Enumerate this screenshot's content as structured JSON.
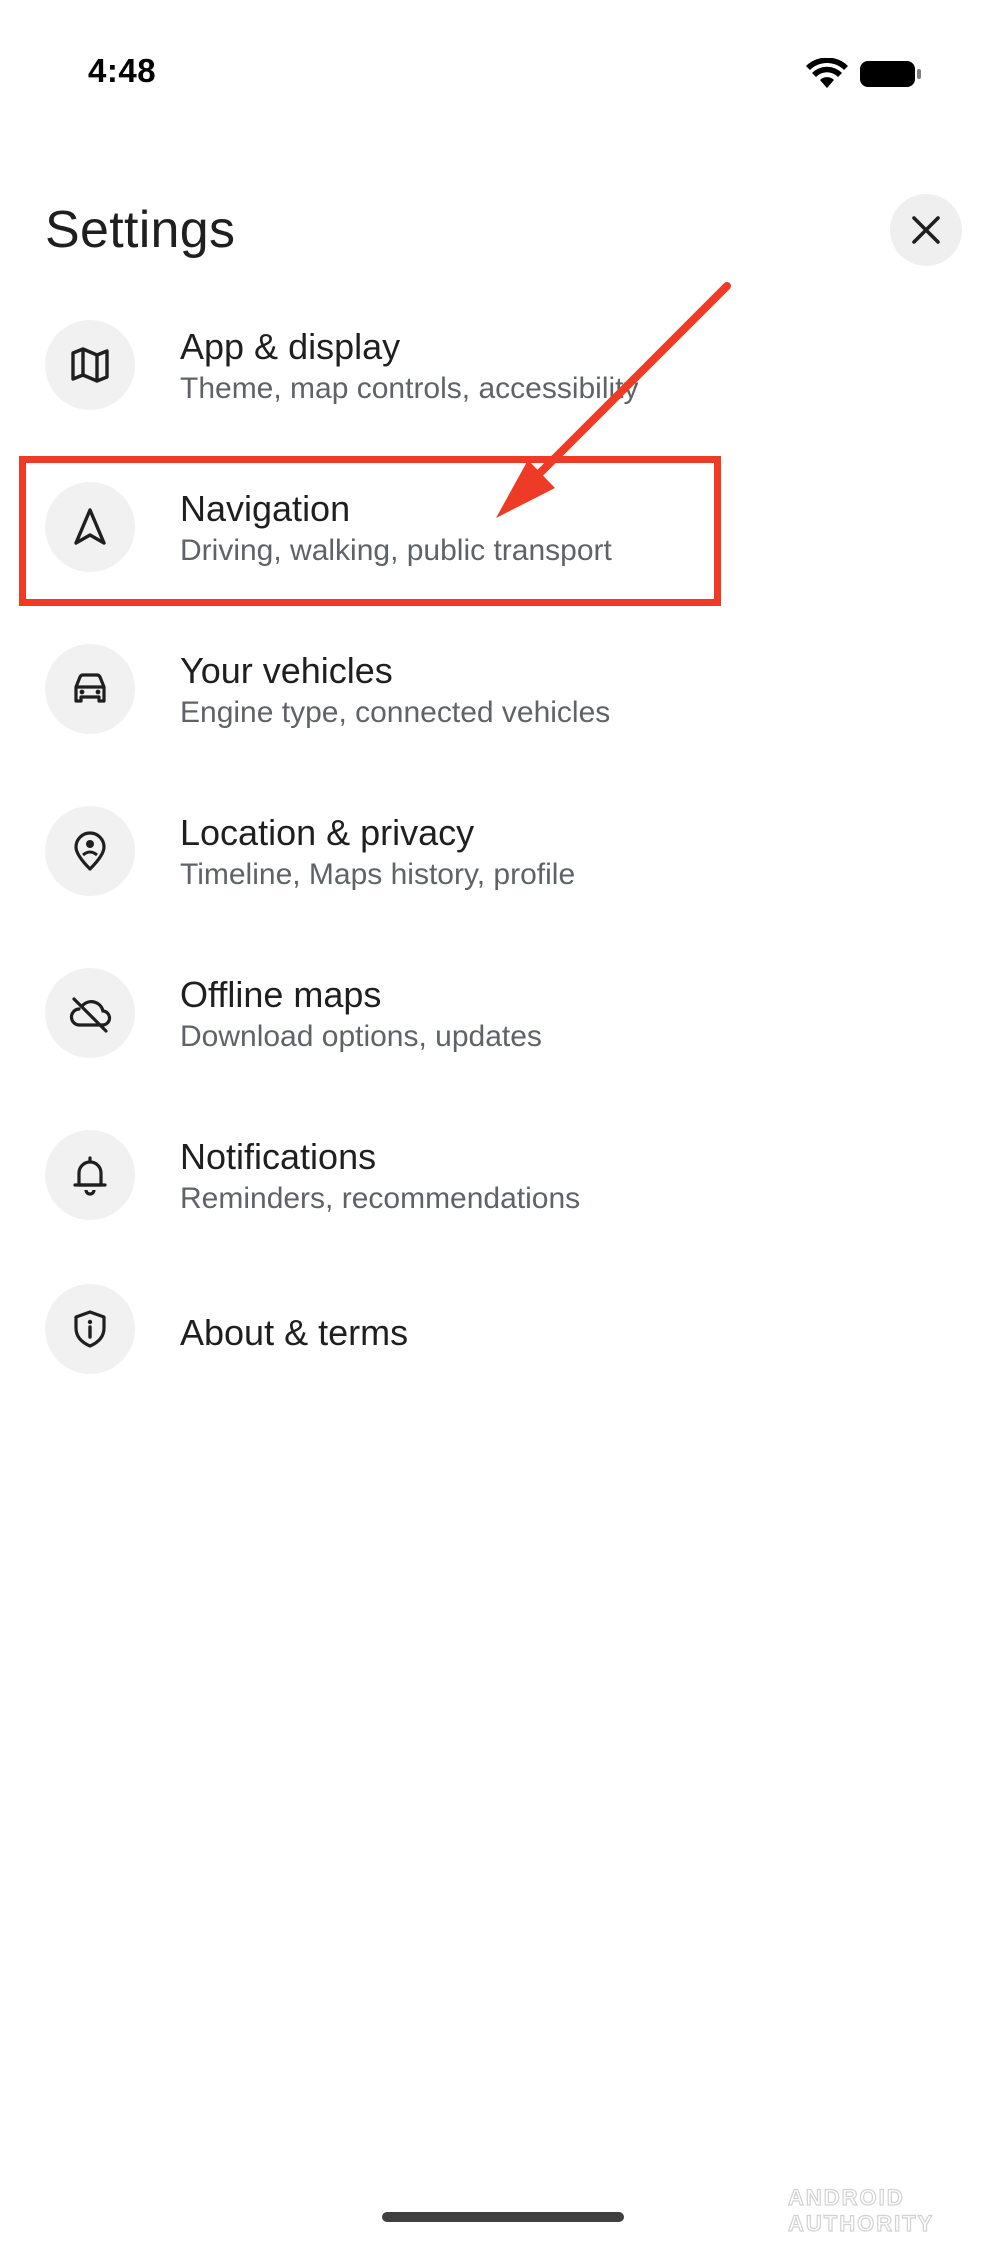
{
  "status_bar": {
    "time": "4:48"
  },
  "page": {
    "title": "Settings"
  },
  "settings_items": [
    {
      "label": "App & display",
      "sub": "Theme, map controls, accessibility",
      "icon": "map-icon"
    },
    {
      "label": "Navigation",
      "sub": "Driving, walking, public transport",
      "icon": "navigation-arrow-icon"
    },
    {
      "label": "Your vehicles",
      "sub": "Engine type, connected vehicles",
      "icon": "car-icon"
    },
    {
      "label": "Location & privacy",
      "sub": "Timeline, Maps history, profile",
      "icon": "location-person-icon"
    },
    {
      "label": "Offline maps",
      "sub": "Download options, updates",
      "icon": "cloud-off-icon"
    },
    {
      "label": "Notifications",
      "sub": "Reminders, recommendations",
      "icon": "bell-icon"
    },
    {
      "label": "About & terms",
      "icon": "shield-info-icon"
    }
  ],
  "annotation": {
    "highlight_color": "#ee3b25",
    "highlighted_item": "Navigation"
  },
  "watermark": {
    "text": "ANDROID AUTHORITY"
  },
  "colors": {
    "background": "#ffffff",
    "primary_text": "#1f1f1f",
    "secondary_text": "#5f6368",
    "icon_circle": "#f1f1f1"
  }
}
